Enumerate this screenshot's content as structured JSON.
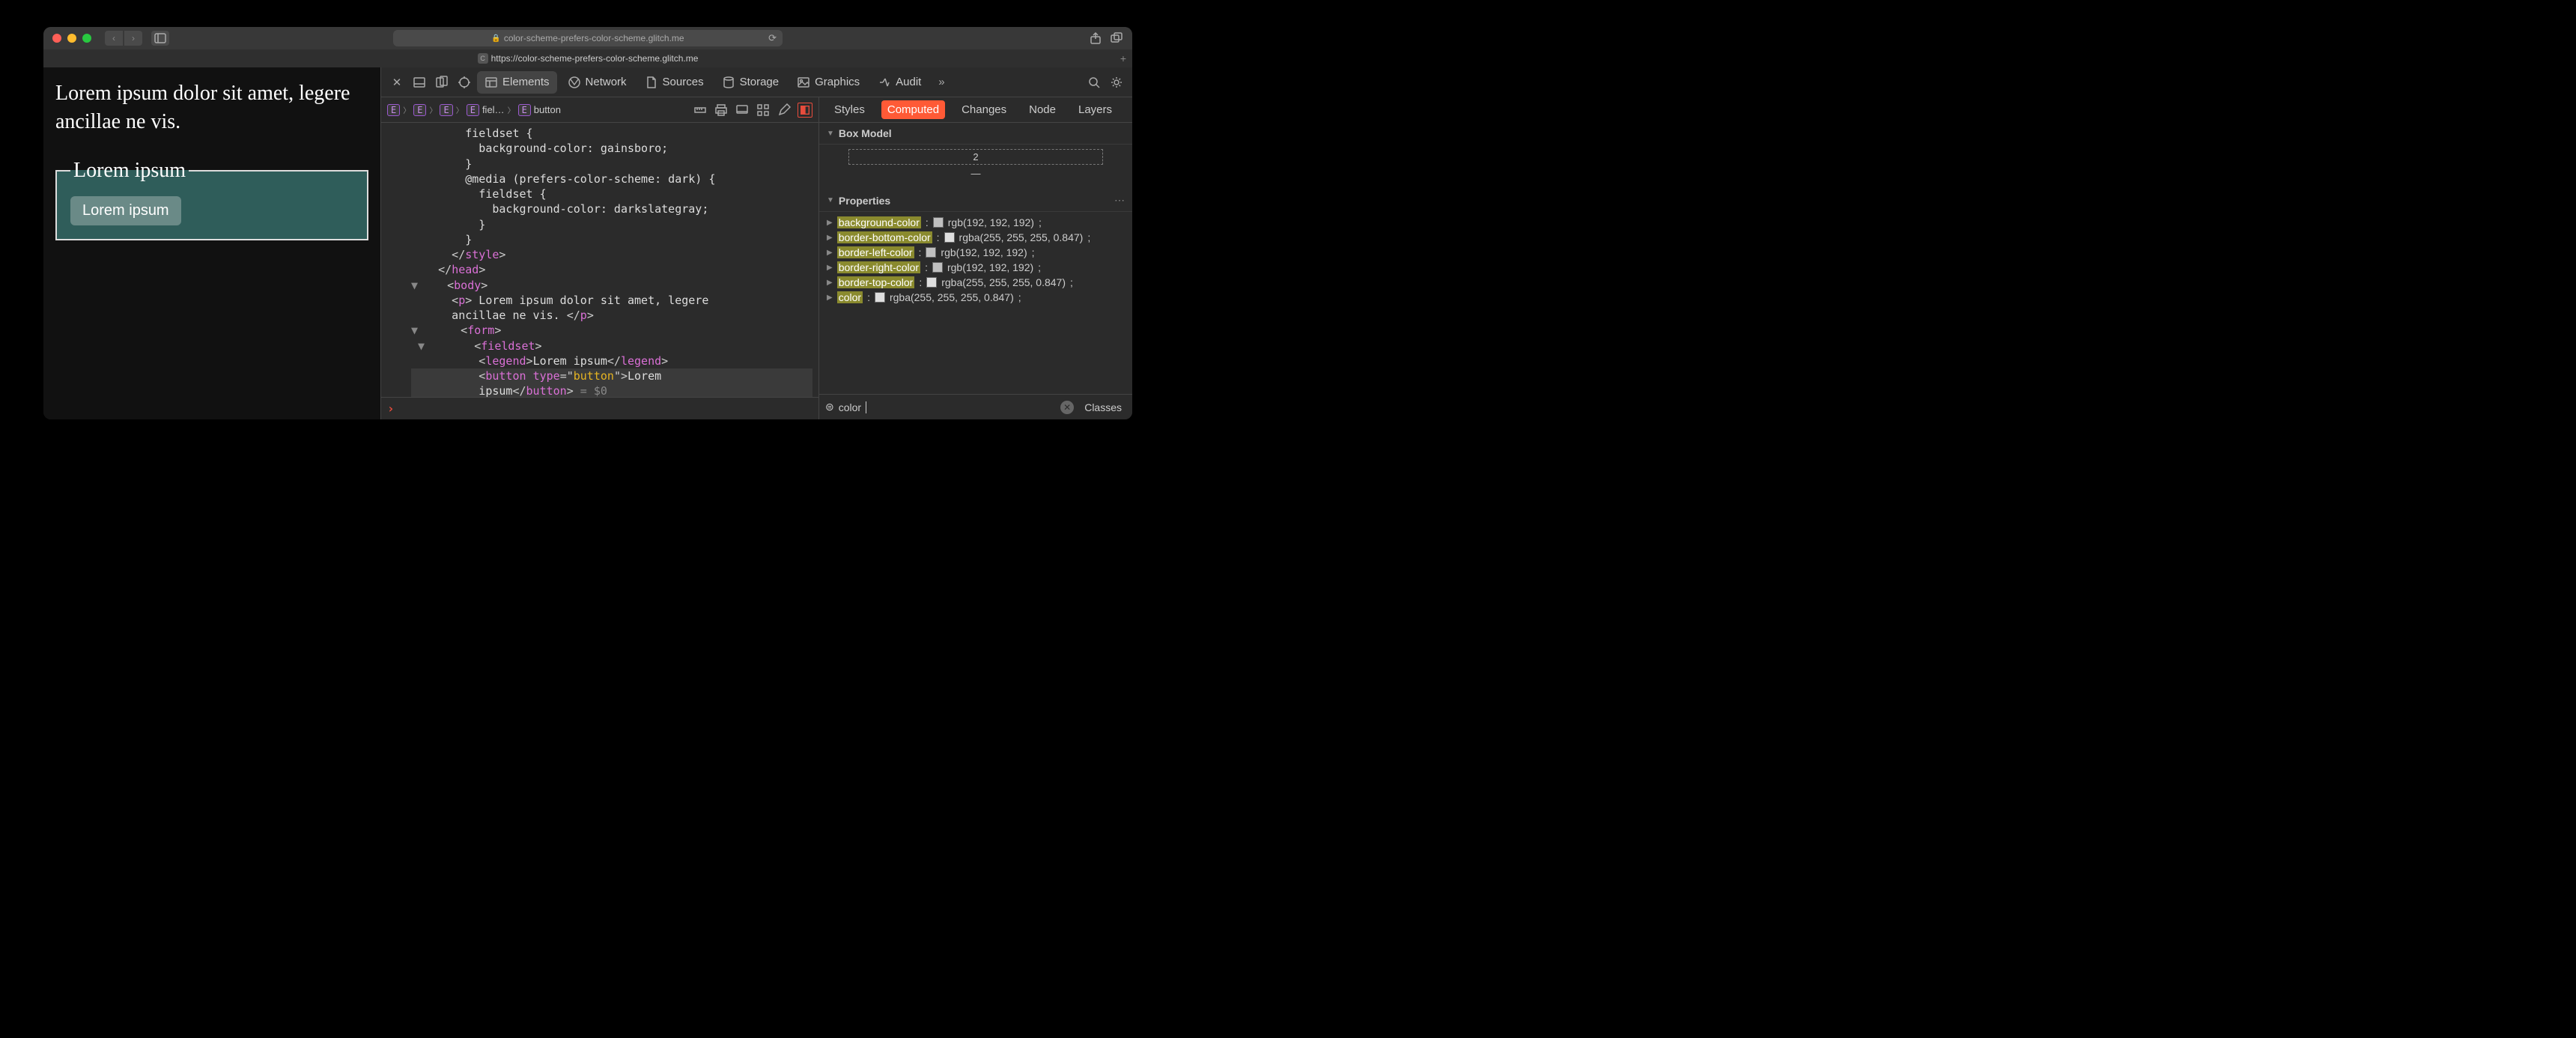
{
  "titlebar": {
    "url_display": "color-scheme-prefers-color-scheme.glitch.me"
  },
  "tab": {
    "url": "https://color-scheme-prefers-color-scheme.glitch.me"
  },
  "page": {
    "paragraph": "Lorem ipsum dolor sit amet, legere ancillae ne vis.",
    "legend": "Lorem ipsum",
    "button": "Lorem ipsum"
  },
  "devtools_tabs": {
    "elements": "Elements",
    "network": "Network",
    "sources": "Sources",
    "storage": "Storage",
    "graphics": "Graphics",
    "audit": "Audit"
  },
  "breadcrumb": {
    "item4": "fiel…",
    "item5": "button"
  },
  "source": {
    "l1": "        fieldset {",
    "l2": "          background-color: gainsboro;",
    "l3": "        }",
    "l4": "        @media (prefers-color-scheme: dark) {",
    "l5": "          fieldset {",
    "l6": "            background-color: darkslategray;",
    "l7": "          }",
    "l8": "        }",
    "l9_open": "      </",
    "l9_tag": "style",
    "l9_close": ">",
    "l10_open": "    </",
    "l10_tag": "head",
    "l10_close": ">",
    "l11_open": "    <",
    "l11_tag": "body",
    "l11_close": ">",
    "l12_a": "      <",
    "l12_tag": "p",
    "l12_b": ">",
    "l12_txt": " Lorem ipsum dolor sit amet, legere",
    "l13_txt": "      ancillae ne vis. ",
    "l13_a": "</",
    "l13_tag": "p",
    "l13_b": ">",
    "l14_a": "      <",
    "l14_tag": "form",
    "l14_b": ">",
    "l15_a": "        <",
    "l15_tag": "fieldset",
    "l15_b": ">",
    "l16_a": "          <",
    "l16_tag": "legend",
    "l16_b": ">",
    "l16_txt": "Lorem ipsum",
    "l16_c": "</",
    "l16_tag2": "legend",
    "l16_d": ">",
    "l17_a": "          <",
    "l17_tag": "button",
    "l17_sp": " ",
    "l17_attr": "type",
    "l17_eq": "=\"",
    "l17_val": "button",
    "l17_q": "\"",
    "l17_b": ">",
    "l17_txt": "Lorem",
    "l18_txt": "          ipsum",
    "l18_a": "</",
    "l18_tag": "button",
    "l18_b": ">",
    "l18_sel": " = $0"
  },
  "right_tabs": {
    "styles": "Styles",
    "computed": "Computed",
    "changes": "Changes",
    "node": "Node",
    "layers": "Layers"
  },
  "box_model": {
    "title": "Box Model",
    "border_top": "2",
    "content": "—"
  },
  "properties": {
    "title": "Properties",
    "rows": [
      {
        "name": "background-color",
        "swatch": "#c0c0c0",
        "value": "rgb(192, 192, 192)"
      },
      {
        "name": "border-bottom-color",
        "swatch": "#ffffffd8",
        "value": "rgba(255, 255, 255, 0.847)"
      },
      {
        "name": "border-left-color",
        "swatch": "#c0c0c0",
        "value": "rgb(192, 192, 192)"
      },
      {
        "name": "border-right-color",
        "swatch": "#c0c0c0",
        "value": "rgb(192, 192, 192)"
      },
      {
        "name": "border-top-color",
        "swatch": "#ffffffd8",
        "value": "rgba(255, 255, 255, 0.847)"
      },
      {
        "name": "color",
        "swatch": "#ffffffd8",
        "value": "rgba(255, 255, 255, 0.847)"
      }
    ]
  },
  "filter": {
    "value": "color",
    "classes": "Classes"
  }
}
